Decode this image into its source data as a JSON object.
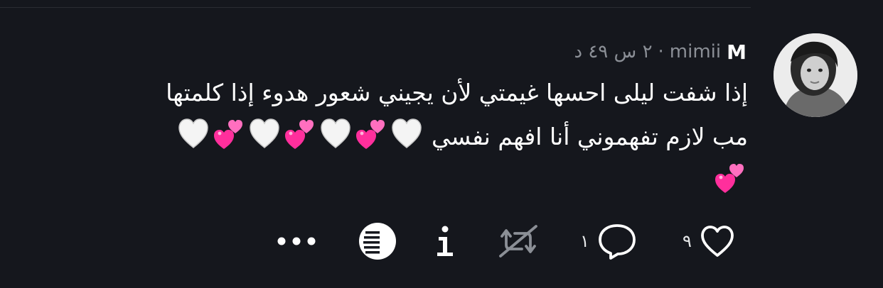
{
  "tweet": {
    "display_name": "M",
    "username": "mimii",
    "separator": "·",
    "time": "٢ س ٤٩ د",
    "text_line1": "إذا شفت ليلى احسها غيمتي لأن يجيني شعور هدوء إذا كلمتها",
    "text_line2": "مب لازم تفهموني أنا افهم نفسي",
    "emoji_sequence_line2": [
      "white-heart",
      "two-hearts",
      "white-heart",
      "two-hearts",
      "white-heart",
      "two-hearts",
      "white-heart"
    ],
    "emoji_sequence_line3": [
      "two-hearts"
    ]
  },
  "actions": {
    "like_count": "٩",
    "reply_count": "١",
    "like_icon": "heart-outline-icon",
    "reply_icon": "speech-bubble-icon",
    "retweet_icon": "retweet-disabled-icon",
    "info_icon": "info-icon",
    "list_icon": "list-circle-icon",
    "more_icon": "more-dots-icon"
  },
  "colors": {
    "background": "#15171d",
    "text": "#ffffff",
    "muted": "#8b8f96",
    "pink_heart": "#ff3fa4"
  }
}
